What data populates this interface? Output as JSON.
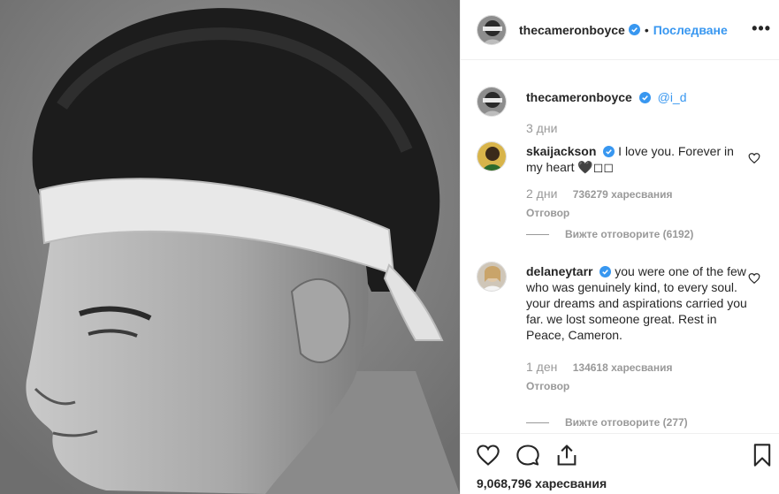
{
  "header": {
    "username": "thecameronboyce",
    "separator": "•",
    "follow_label": "Последване",
    "more_label": "•••"
  },
  "caption": {
    "username": "thecameronboyce",
    "text": "@i_d",
    "time": "3 дни"
  },
  "comments": [
    {
      "username": "skaijackson",
      "text": "I love you. Forever in my heart 🖤◻◻",
      "time": "2 дни",
      "likes": "736279 харесвания",
      "reply": "Отговор",
      "view_replies": "Вижте отговорите (6192)"
    },
    {
      "username": "delaneytarr",
      "text": "you were one of the few who was genuinely kind, to every soul. your dreams and aspirations carried you far. we lost someone great. Rest in Peace, Cameron.",
      "time": "1 ден",
      "likes": "134618 харесвания",
      "reply": "Отговор",
      "view_replies": "Вижте отговорите (277)"
    }
  ],
  "footer": {
    "likes": "9,068,796 харесвания",
    "icons": [
      "heart-icon",
      "comment-icon",
      "share-icon",
      "bookmark-icon"
    ]
  },
  "colors": {
    "accent": "#3897f0",
    "text": "#262626",
    "muted": "#999999"
  }
}
